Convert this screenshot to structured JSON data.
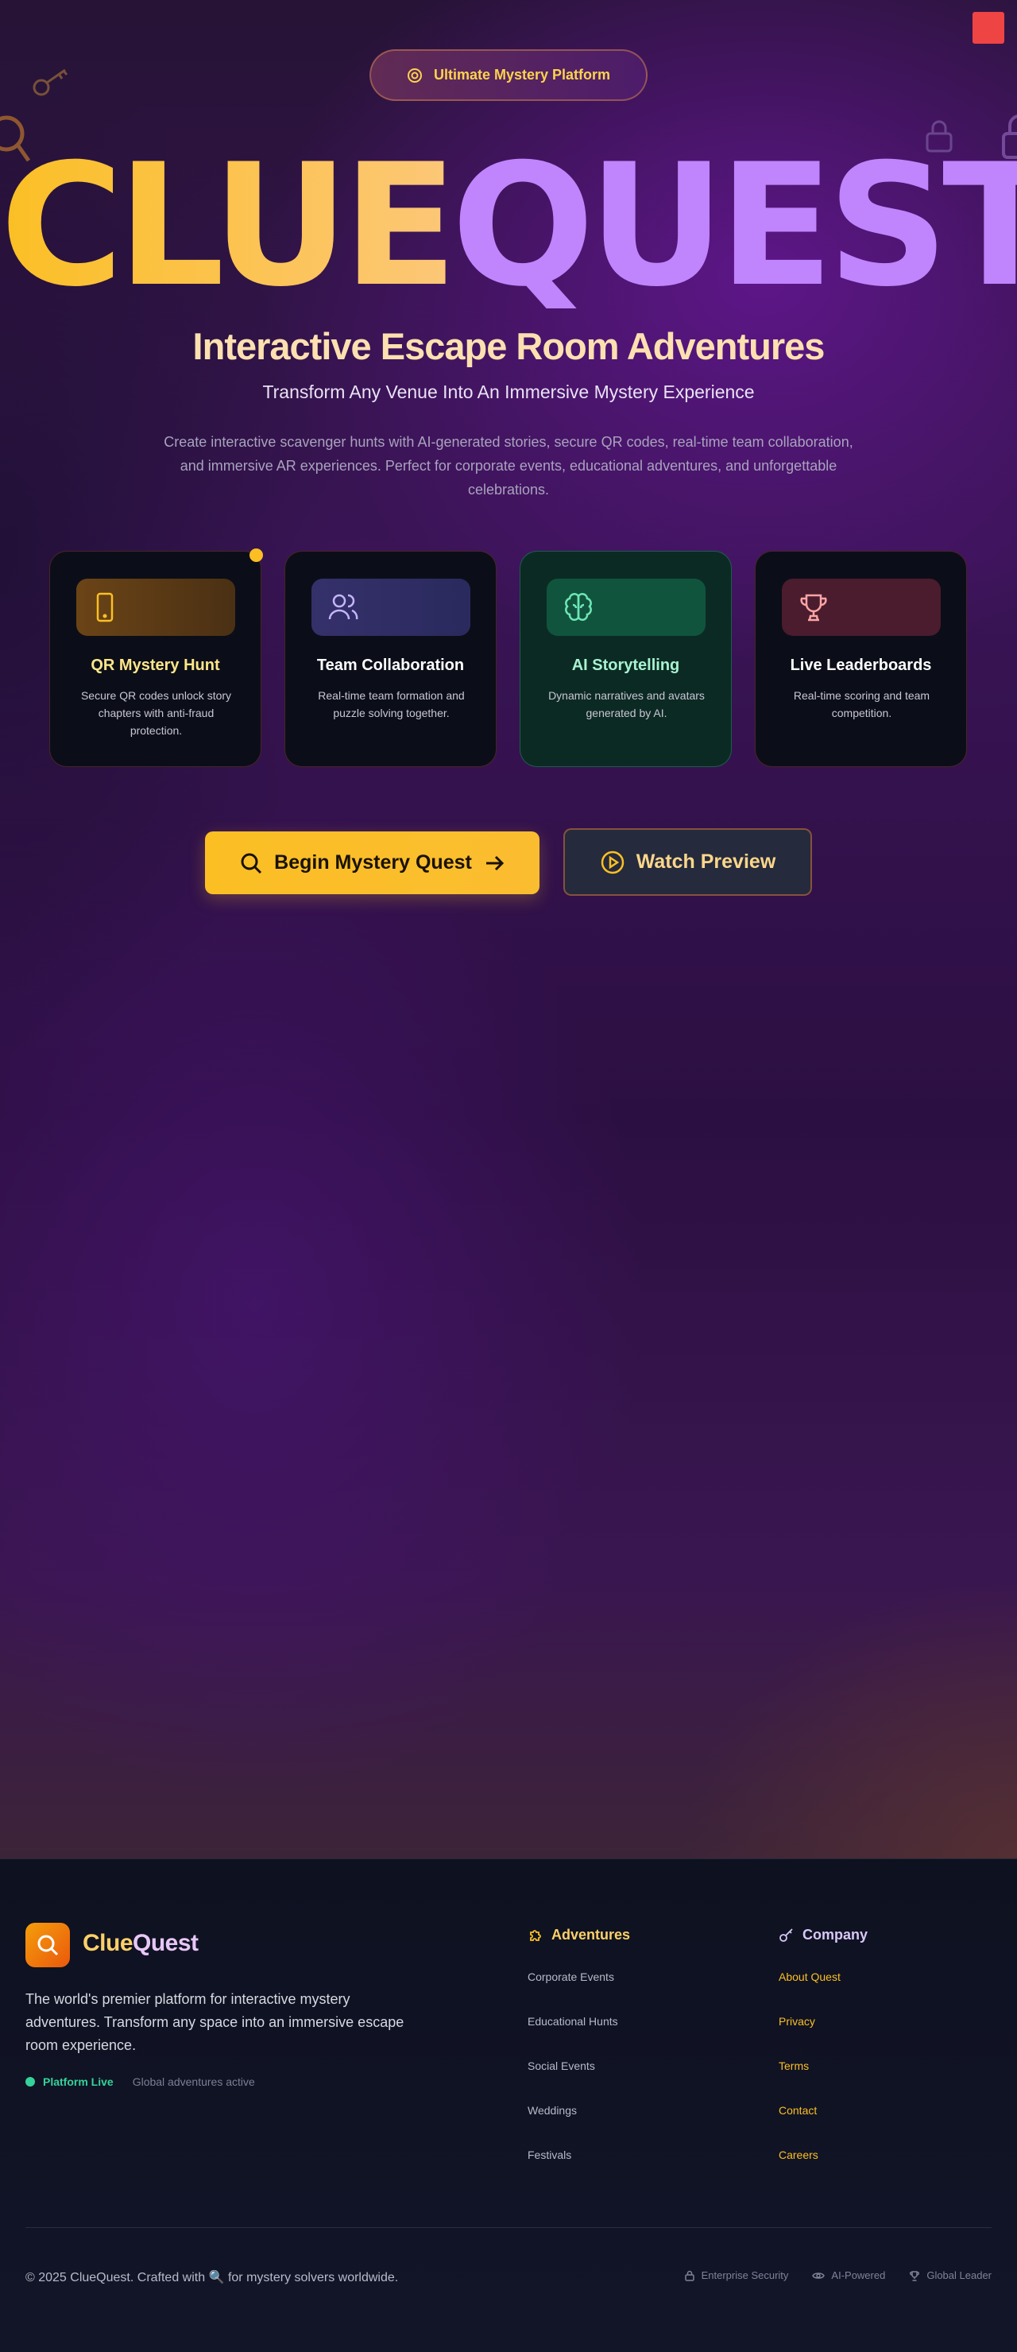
{
  "colors": {
    "accent_gold": "#fbbf24",
    "accent_purple": "#c084fc",
    "live_green": "#34d399",
    "close_red": "#ef4444"
  },
  "hero": {
    "badge_label": "Ultimate Mystery Platform",
    "badge_icon": "target-icon",
    "logo_part1": "CLUE",
    "logo_part2": "QUEST",
    "subtitle": "Interactive Escape Room Adventures",
    "tagline": "Transform Any Venue Into An Immersive Mystery Experience",
    "description": "Create interactive scavenger hunts with AI-generated stories, secure QR codes, real-time team collaboration, and immersive AR experiences. Perfect for corporate events, educational adventures, and unforgettable celebrations."
  },
  "features": [
    {
      "title": "QR Mystery Hunt",
      "text": "Secure QR codes unlock story chapters with anti-fraud protection.",
      "icon": "smartphone-icon",
      "title_color": "#fde68a",
      "chip_color": "#5a3a14"
    },
    {
      "title": "Team Collaboration",
      "text": "Real-time team formation and puzzle solving together.",
      "icon": "users-icon",
      "title_color": "#ffffff",
      "chip_color": "#2e2a5c"
    },
    {
      "title": "AI Storytelling",
      "text": "Dynamic narratives and avatars generated by AI.",
      "icon": "brain-icon",
      "title_color": "#a7f3d0",
      "chip_color": "#11543e"
    },
    {
      "title": "Live Leaderboards",
      "text": "Real-time scoring and team competition.",
      "icon": "trophy-icon",
      "title_color": "#ffffff",
      "chip_color": "#4a1c2e"
    }
  ],
  "cta": {
    "primary_label": "Begin Mystery Quest",
    "secondary_label": "Watch Preview"
  },
  "footer": {
    "brand_part1": "Clue",
    "brand_part2": "Quest",
    "about": "The world's premier platform for interactive mystery adventures. Transform any space into an immersive escape room experience.",
    "status_live": "Platform Live",
    "status_active": "Global adventures active",
    "adventures_heading": "Adventures",
    "adventures": [
      "Corporate Events",
      "Educational Hunts",
      "Social Events",
      "Weddings",
      "Festivals"
    ],
    "company_heading": "Company",
    "company": [
      "About Quest",
      "Privacy",
      "Terms",
      "Contact",
      "Careers"
    ],
    "copyright_prefix": "© 2025 ClueQuest. Crafted with",
    "copyright_suffix": "for mystery solvers worldwide.",
    "badges": [
      "Enterprise Security",
      "AI-Powered",
      "Global Leader"
    ]
  }
}
